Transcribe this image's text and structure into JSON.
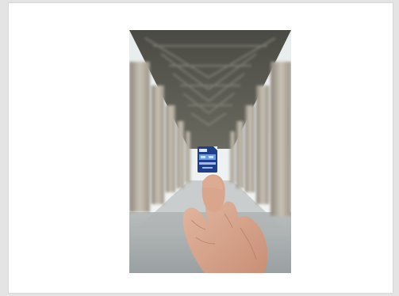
{
  "viewer": {
    "background_color": "#e4e4e4",
    "frame_color": "#ffffff"
  },
  "photo": {
    "subject": "hand-holding-sd-card",
    "card": {
      "capacity_label": "",
      "brand_label": ""
    }
  }
}
